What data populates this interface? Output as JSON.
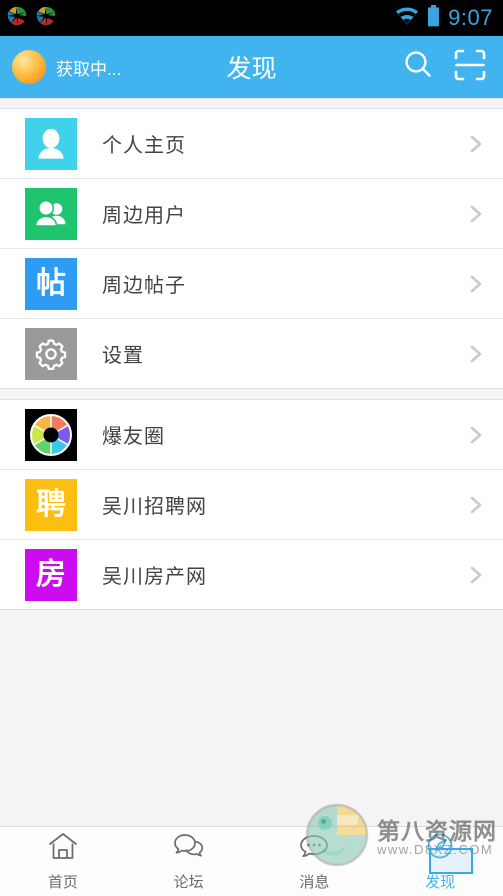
{
  "status_bar": {
    "notification_icons": [
      "app-logo-icon",
      "app-logo-icon"
    ],
    "wifi_icon": "wifi-icon",
    "battery_icon": "battery-icon",
    "time": "9:07"
  },
  "header": {
    "avatar_icon": "user-avatar",
    "avatar_label": "获取中...",
    "title": "发现",
    "search_icon": "search-icon",
    "scan_icon": "qr-scan-icon",
    "background_color": "#41b4f0"
  },
  "groups": [
    {
      "items": [
        {
          "label": "个人主页",
          "icon": "person-icon",
          "tile_color": "#3fd2ea",
          "chevron": "chevron-right-icon"
        },
        {
          "label": "周边用户",
          "icon": "people-icon",
          "tile_color": "#1ec46e",
          "chevron": "chevron-right-icon"
        },
        {
          "label": "周边帖子",
          "icon": "post-glyph-icon",
          "glyph": "帖",
          "tile_color": "#2f9cf4",
          "chevron": "chevron-right-icon"
        },
        {
          "label": "设置",
          "icon": "gear-icon",
          "tile_color": "#9a9a9a",
          "chevron": "chevron-right-icon"
        }
      ]
    },
    {
      "items": [
        {
          "label": "爆友圈",
          "icon": "aperture-icon",
          "tile_color": "#000000",
          "chevron": "chevron-right-icon"
        },
        {
          "label": "吴川招聘网",
          "icon": "recruit-glyph-icon",
          "glyph": "聘",
          "tile_color": "#fcbe10",
          "chevron": "chevron-right-icon"
        },
        {
          "label": "吴川房产网",
          "icon": "house-glyph-icon",
          "glyph": "房",
          "tile_color": "#cd0bf0",
          "chevron": "chevron-right-icon"
        }
      ]
    }
  ],
  "tabbar": {
    "active_color": "#41b4f0",
    "tabs": [
      {
        "label": "首页",
        "icon": "home-icon",
        "active": false
      },
      {
        "label": "论坛",
        "icon": "chat-bubbles-icon",
        "active": false
      },
      {
        "label": "消息",
        "icon": "message-icon",
        "active": false
      },
      {
        "label": "发现",
        "icon": "compass-icon",
        "active": true
      }
    ]
  },
  "watermark": {
    "logo_icon": "site-logo-icon",
    "title": "第八资源网",
    "url": "www.D8XZ.COM"
  }
}
